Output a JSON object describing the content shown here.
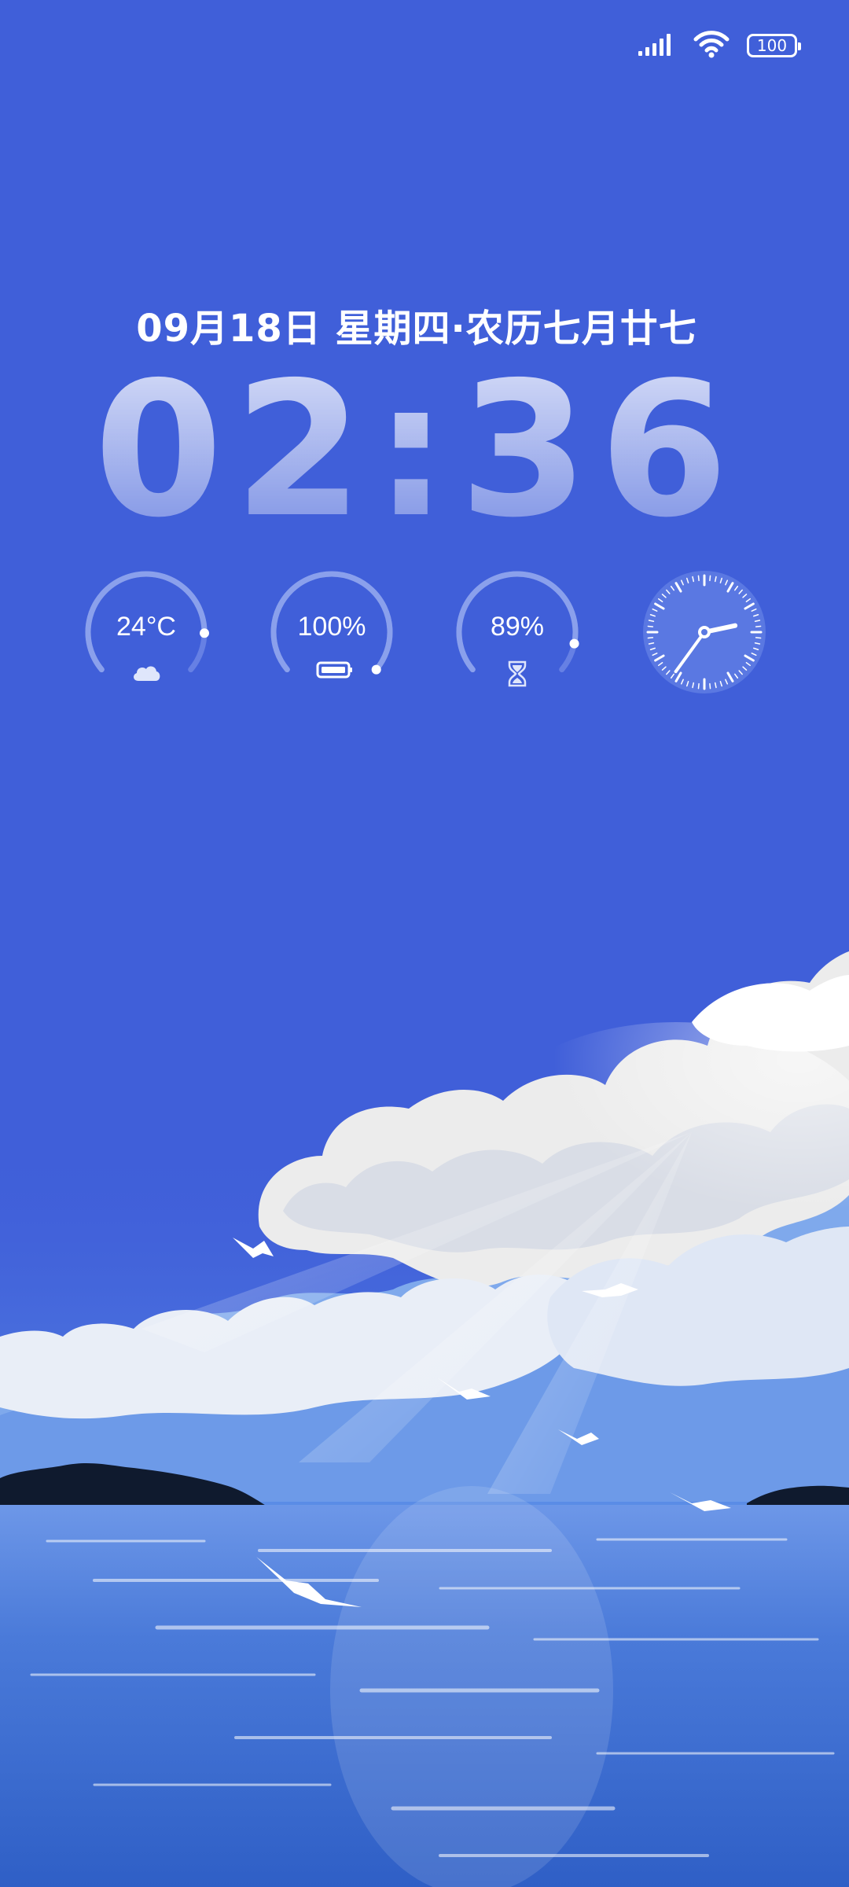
{
  "status_bar": {
    "signal_icon": "signal-icon",
    "wifi_icon": "wifi-icon",
    "battery_level": "100"
  },
  "lockscreen": {
    "date_text": "09月18日 星期四·农历七月廿七",
    "time_text": "02:36"
  },
  "widgets": {
    "weather": {
      "value": "24°C",
      "icon": "cloud-icon",
      "level": 0.85
    },
    "battery": {
      "value": "100%",
      "icon": "battery-icon",
      "level": 1.0
    },
    "screen_time": {
      "value": "89%",
      "icon": "hourglass-icon",
      "level": 0.89
    },
    "analog_clock": {
      "hour": 2,
      "minute": 36
    }
  },
  "colors": {
    "background": "#405fd9",
    "ring_track": "#6680e4",
    "ring_fill": "#ffffff"
  }
}
